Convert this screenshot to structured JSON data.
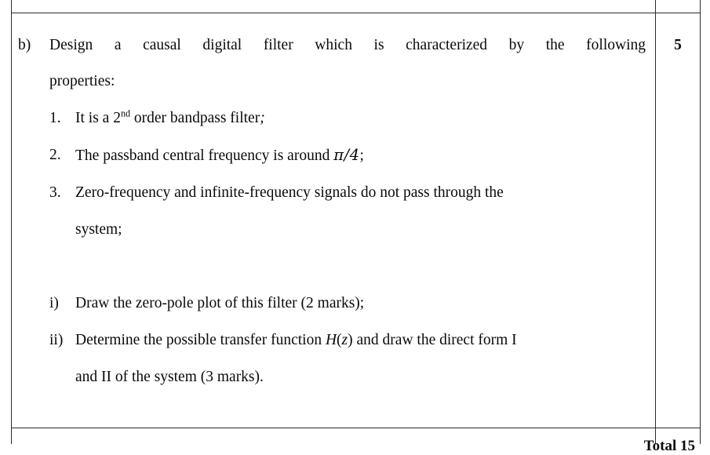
{
  "document": {
    "type": "exam-question-table",
    "question_label": "b)",
    "marks": "5"
  },
  "question": {
    "stem_line1": "Design a causal digital filter which is characterized by the following",
    "stem_line2": "properties:",
    "properties": [
      {
        "marker": "1.",
        "text_before_sup": "It is a 2",
        "sup": "nd",
        "text_after_sup": " order bandpass filter",
        "terminator": ";"
      },
      {
        "marker": "2.",
        "text_before_math": "The passband central frequency is around ",
        "math": "π/4",
        "terminator": ";"
      },
      {
        "marker": "3.",
        "text": "Zero-frequency and infinite-frequency signals do not pass through the",
        "continuation": "system;"
      }
    ],
    "subquestions": [
      {
        "marker": "i)",
        "text": "Draw the zero-pole plot of this filter (2 marks);"
      },
      {
        "marker": "ii)",
        "text_before_math": "Determine the possible transfer function ",
        "math_italic": "H",
        "math_paren_open": "(",
        "math_var": "z",
        "math_paren_close": ")",
        "text_after_math": " and draw the direct form I",
        "continuation": "and II of the system (3 marks)."
      }
    ]
  },
  "footer": {
    "total_label": "Total 15"
  },
  "colors": {
    "border": "#2b2b2b",
    "text": "#0a0a0a",
    "background": "#ffffff"
  }
}
